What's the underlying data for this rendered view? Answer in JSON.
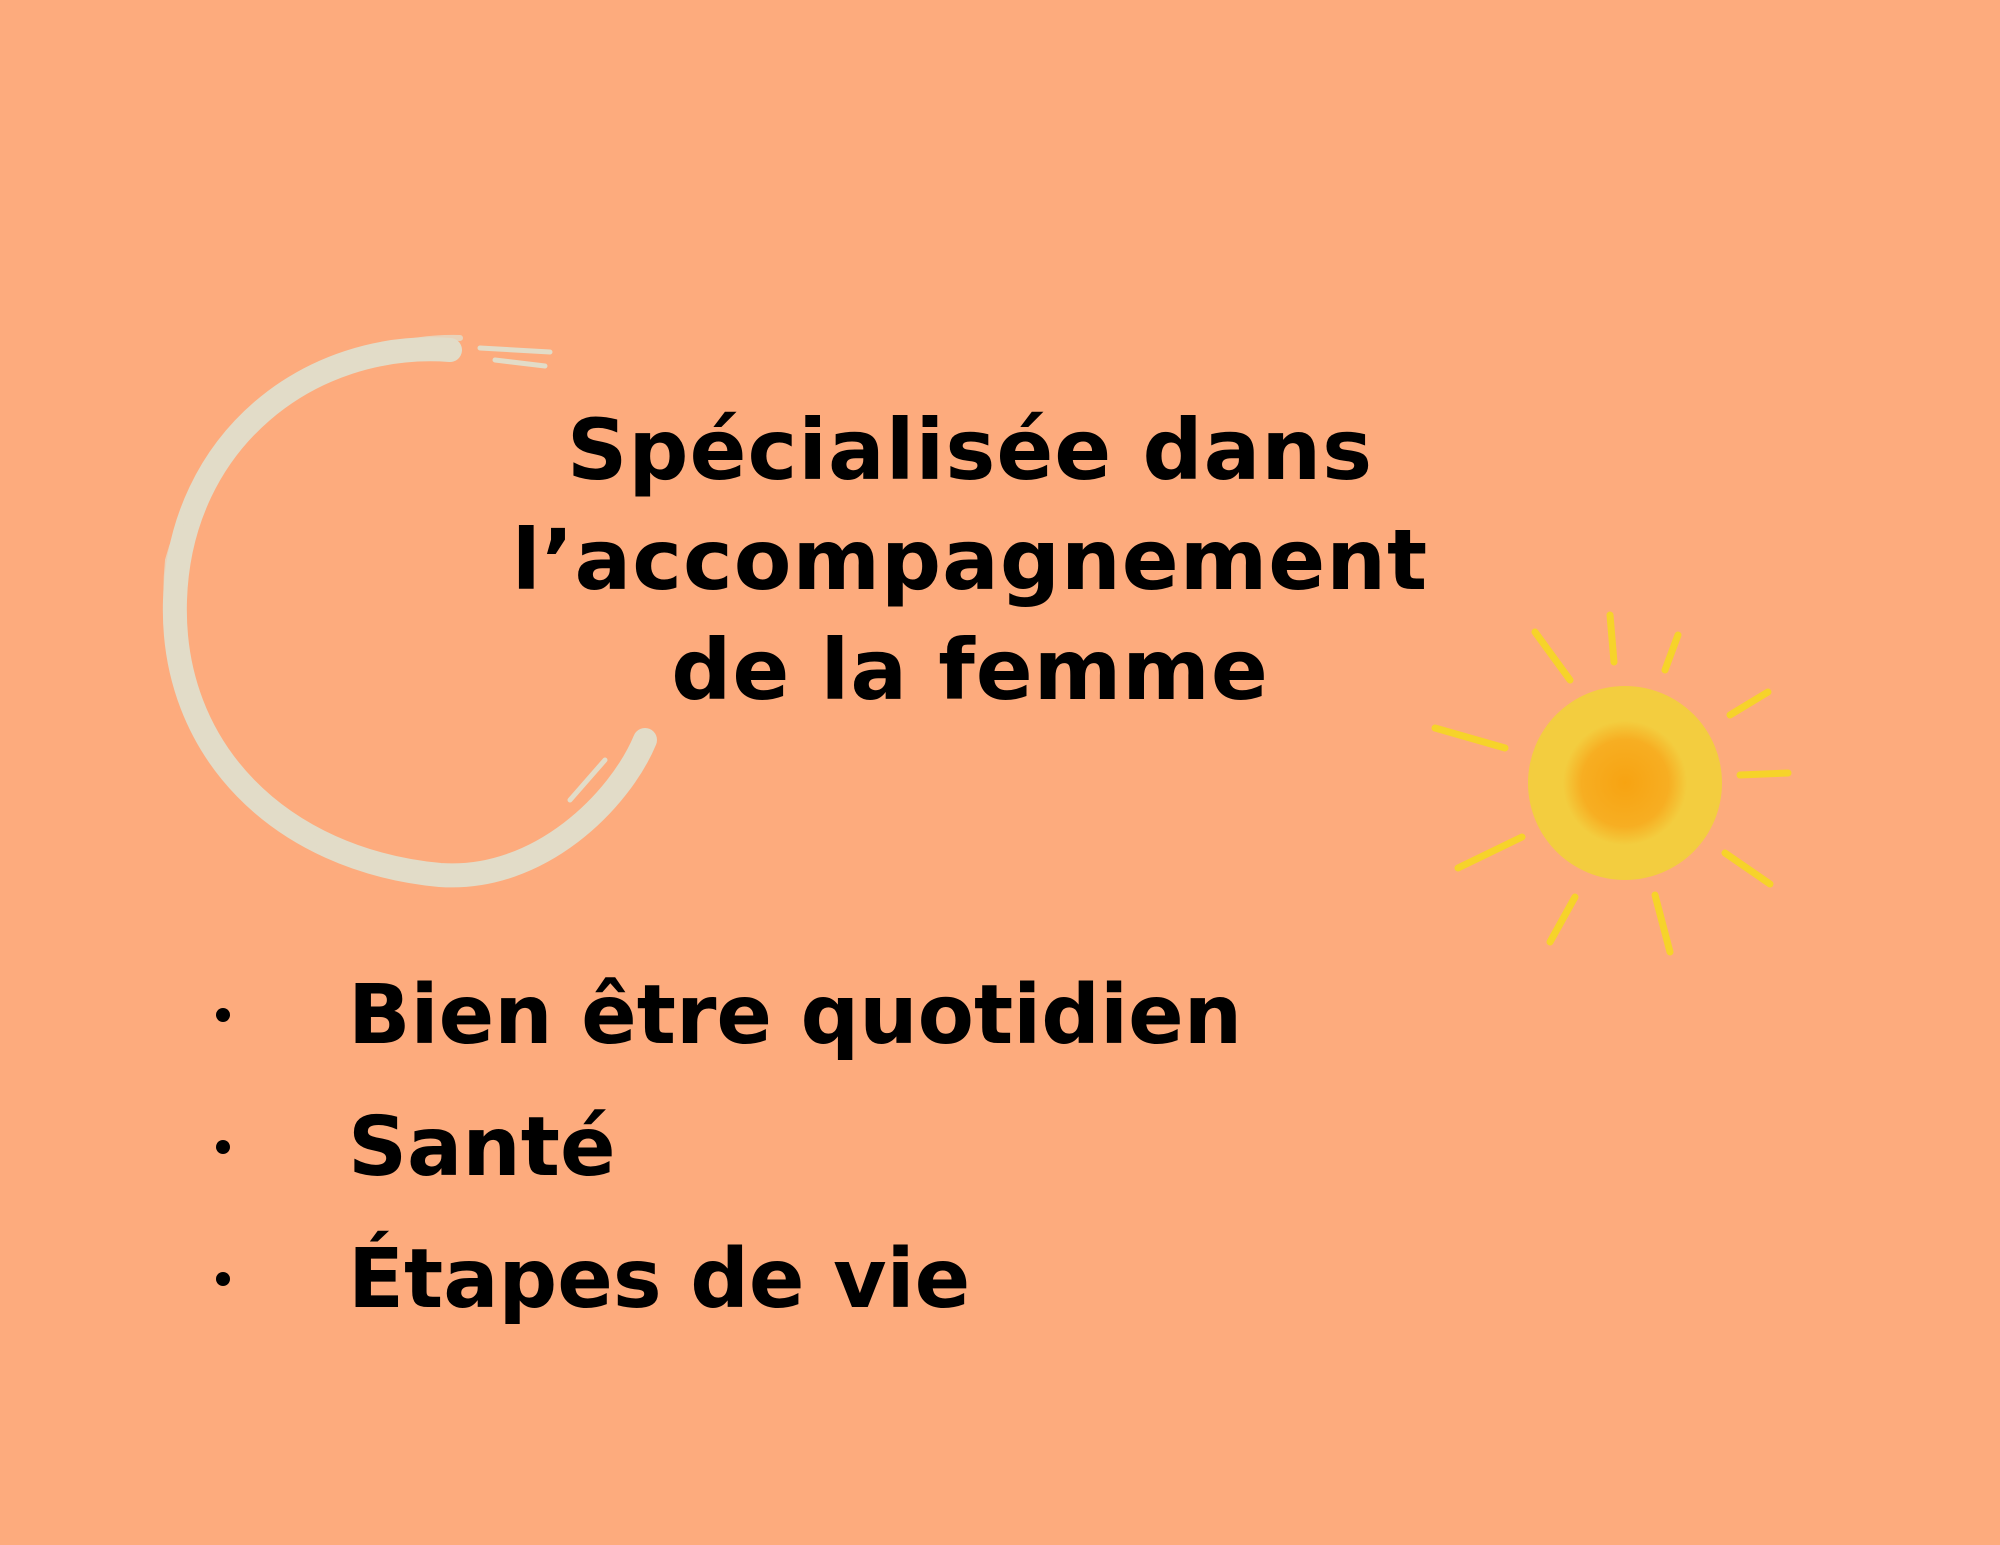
{
  "headline": {
    "lines": [
      "Spécialisée dans",
      "l’accompagnement",
      "de la femme"
    ]
  },
  "topics": [
    "Bien être quotidien",
    "Santé",
    "Étapes de vie"
  ],
  "decorations": {
    "circle": {
      "icon": "brush-stroke-circle",
      "color": "#E2DCC8"
    },
    "sun": {
      "icon": "sun-icon",
      "disc_color": "#F3CD3F",
      "core_color": "#F7A817",
      "ray_color": "#F6D32A"
    }
  },
  "colors": {
    "background": "#FDAB7D",
    "text": "#000000"
  }
}
